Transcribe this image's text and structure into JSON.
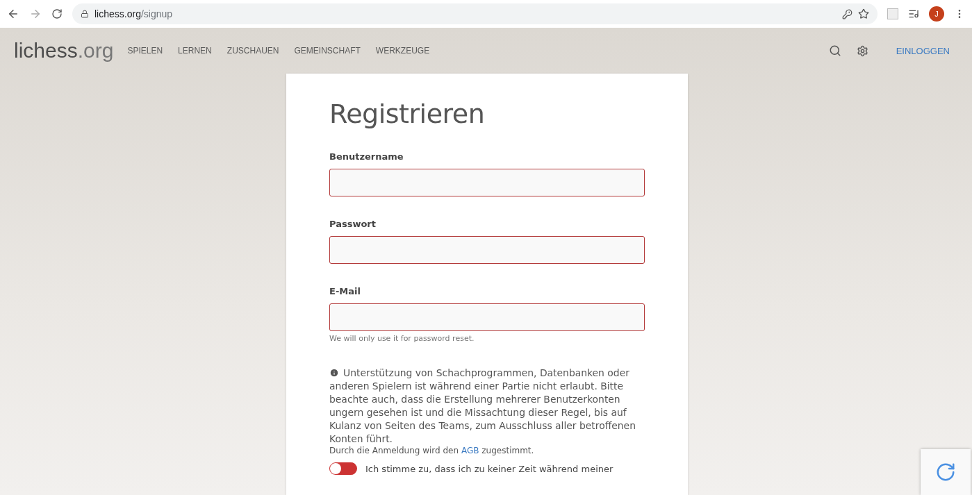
{
  "browser": {
    "url_host": "lichess.org",
    "url_path": "/signup",
    "profile_initial": "J"
  },
  "header": {
    "logo_main": "lichess",
    "logo_suffix": ".org",
    "nav": [
      "SPIELEN",
      "LERNEN",
      "ZUSCHAUEN",
      "GEMEINSCHAFT",
      "WERKZEUGE"
    ],
    "login": "EINLOGGEN"
  },
  "form": {
    "title": "Registrieren",
    "fields": [
      {
        "label": "Benutzername"
      },
      {
        "label": "Passwort"
      },
      {
        "label": "E-Mail",
        "help": "We will only use it for password reset."
      }
    ],
    "notice": "Unterstützung von Schachprogrammen, Datenbanken oder anderen Spielern ist während einer Partie nicht erlaubt. Bitte beachte auch, dass die Erstellung mehrerer Benutzerkonten ungern gesehen ist und die Missachtung dieser Regel, bis auf Kulanz von Seiten des Teams, zum Ausschluss aller betroffenen Konten führt.",
    "terms_before": "Durch die Anmeldung wird den",
    "terms_link": "AGB",
    "terms_after": "zugestimmt.",
    "agreement": {
      "text": "Ich stimme zu, dass ich zu keiner Zeit während meiner",
      "checked": false
    }
  }
}
